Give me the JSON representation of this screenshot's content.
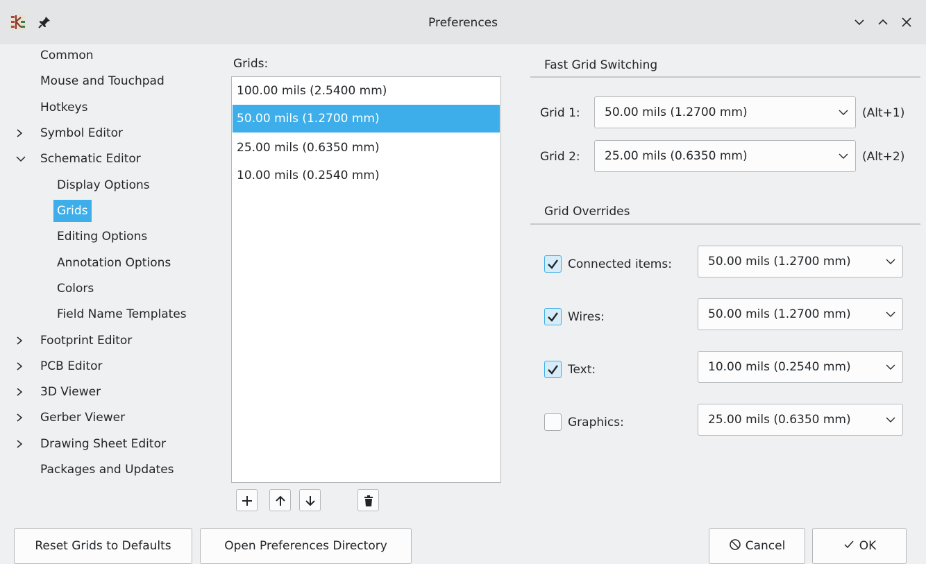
{
  "window": {
    "title": "Preferences"
  },
  "sidebar": {
    "items": [
      {
        "label": "Common"
      },
      {
        "label": "Mouse and Touchpad"
      },
      {
        "label": "Hotkeys"
      },
      {
        "label": "Symbol Editor",
        "expander": "collapsed"
      },
      {
        "label": "Schematic Editor",
        "expander": "expanded"
      },
      {
        "label": "Display Options"
      },
      {
        "label": "Grids",
        "selected": true
      },
      {
        "label": "Editing Options"
      },
      {
        "label": "Annotation Options"
      },
      {
        "label": "Colors"
      },
      {
        "label": "Field Name Templates"
      },
      {
        "label": "Footprint Editor",
        "expander": "collapsed"
      },
      {
        "label": "PCB Editor",
        "expander": "collapsed"
      },
      {
        "label": "3D Viewer",
        "expander": "collapsed"
      },
      {
        "label": "Gerber Viewer",
        "expander": "collapsed"
      },
      {
        "label": "Drawing Sheet Editor",
        "expander": "collapsed"
      },
      {
        "label": "Packages and Updates"
      }
    ]
  },
  "grids": {
    "label": "Grids:",
    "items": [
      {
        "label": "100.00 mils (2.5400 mm)"
      },
      {
        "label": "50.00 mils (1.2700 mm)",
        "selected": true
      },
      {
        "label": "25.00 mils (0.6350 mm)"
      },
      {
        "label": "10.00 mils (0.2540 mm)"
      }
    ]
  },
  "fast_grid": {
    "title": "Fast Grid Switching",
    "grid1": {
      "label": "Grid 1:",
      "value": "50.00 mils (1.2700 mm)",
      "shortcut": "(Alt+1)"
    },
    "grid2": {
      "label": "Grid 2:",
      "value": "25.00 mils (0.6350 mm)",
      "shortcut": "(Alt+2)"
    }
  },
  "overrides": {
    "title": "Grid Overrides",
    "connected": {
      "label": "Connected items:",
      "checked": true,
      "value": "50.00 mils (1.2700 mm)"
    },
    "wires": {
      "label": "Wires:",
      "checked": true,
      "value": "50.00 mils (1.2700 mm)"
    },
    "text": {
      "label": "Text:",
      "checked": true,
      "value": "10.00 mils (0.2540 mm)"
    },
    "graphics": {
      "label": "Graphics:",
      "checked": false,
      "value": "25.00 mils (0.6350 mm)"
    }
  },
  "buttons": {
    "reset": "Reset Grids to Defaults",
    "open_dir": "Open Preferences Directory",
    "cancel": "Cancel",
    "ok": "OK"
  },
  "colors": {
    "accent": "#3daee9",
    "window_bg": "#eff0f1",
    "titlebar_bg": "#e3e5e7"
  },
  "icons": {
    "app": "kicad-app-icon",
    "pin": "pin-icon",
    "add": "plus-icon",
    "up": "arrow-up-icon",
    "down": "arrow-down-icon",
    "delete": "trash-icon",
    "cancel": "cancel-icon",
    "ok": "checkmark-icon"
  }
}
